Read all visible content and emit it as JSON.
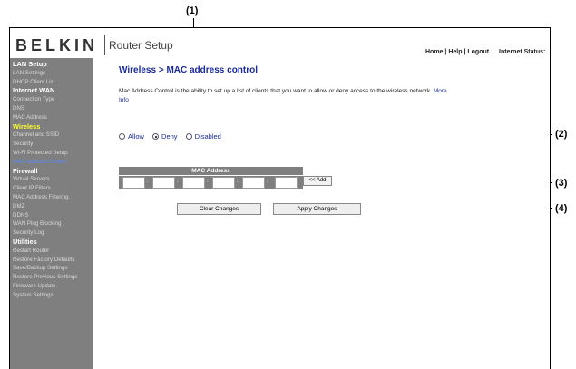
{
  "callouts": [
    "(1)",
    "(2)",
    "(3)",
    "(4)"
  ],
  "header": {
    "logo": "BELKIN",
    "app_title": "Router Setup",
    "links": [
      "Home",
      "Help",
      "Logout"
    ],
    "link_separator": "|",
    "internet_status_label": "Internet Status:"
  },
  "sidebar": {
    "items": [
      {
        "label": "LAN Setup",
        "kind": "head"
      },
      {
        "label": "LAN Settings",
        "kind": "item"
      },
      {
        "label": "DHCP Client List",
        "kind": "item"
      },
      {
        "label": "Internet WAN",
        "kind": "head"
      },
      {
        "label": "Connection Type",
        "kind": "item"
      },
      {
        "label": "DNS",
        "kind": "item"
      },
      {
        "label": "MAC Address",
        "kind": "item"
      },
      {
        "label": "Wireless",
        "kind": "active-head"
      },
      {
        "label": "Channel and SSID",
        "kind": "item"
      },
      {
        "label": "Security",
        "kind": "item"
      },
      {
        "label": "Wi-Fi Protected Setup",
        "kind": "item"
      },
      {
        "label": "MAC Address Control",
        "kind": "active"
      },
      {
        "label": "Firewall",
        "kind": "head"
      },
      {
        "label": "Virtual Servers",
        "kind": "item"
      },
      {
        "label": "Client IP Filters",
        "kind": "item"
      },
      {
        "label": "MAC Address Filtering",
        "kind": "item"
      },
      {
        "label": "DMZ",
        "kind": "item"
      },
      {
        "label": "DDNS",
        "kind": "item"
      },
      {
        "label": "WAN Ping Blocking",
        "kind": "item"
      },
      {
        "label": "Security Log",
        "kind": "item"
      },
      {
        "label": "Utilities",
        "kind": "head"
      },
      {
        "label": "Restart Router",
        "kind": "item"
      },
      {
        "label": "Restore Factory Defaults",
        "kind": "item"
      },
      {
        "label": "Save/Backup Settings",
        "kind": "item"
      },
      {
        "label": "Restore Previous Settings",
        "kind": "item"
      },
      {
        "label": "Firmware Update",
        "kind": "item"
      },
      {
        "label": "System Settings",
        "kind": "item"
      }
    ]
  },
  "main": {
    "title": "Wireless > MAC address control",
    "description": "Mac Address Control is the ability to set up a list of clients that you want to allow or deny access to the wireless network.",
    "more_info": "More Info",
    "mode_options": [
      {
        "label": "Allow",
        "checked": false
      },
      {
        "label": "Deny",
        "checked": true
      },
      {
        "label": "Disabled",
        "checked": false
      }
    ],
    "mac_table_header": "MAC Address",
    "mac_octets": [
      "",
      "",
      "",
      "",
      "",
      ""
    ],
    "octet_separator": ":",
    "add_button": "<< Add",
    "clear_button": "Clear Changes",
    "apply_button": "Apply Changes"
  }
}
